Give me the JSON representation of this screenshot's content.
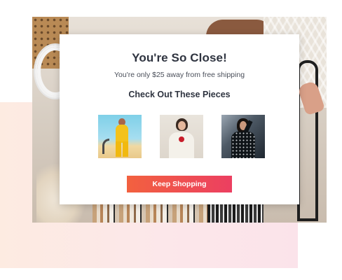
{
  "modal": {
    "title": "You're So Close!",
    "subtitle": "You're only $25 away from free shipping",
    "section_title": "Check Out These Pieces",
    "products": [
      {
        "image": "woman-in-yellow-outfit"
      },
      {
        "image": "woman-in-white-blazer-with-red-rose"
      },
      {
        "image": "woman-in-black-sequin-dress"
      }
    ],
    "cta_label": "Keep Shopping"
  },
  "colors": {
    "cta_start": "#f2613f",
    "cta_end": "#ec3f61",
    "title_text": "#2f3440",
    "backdrop_pink": "#fce7ea"
  }
}
